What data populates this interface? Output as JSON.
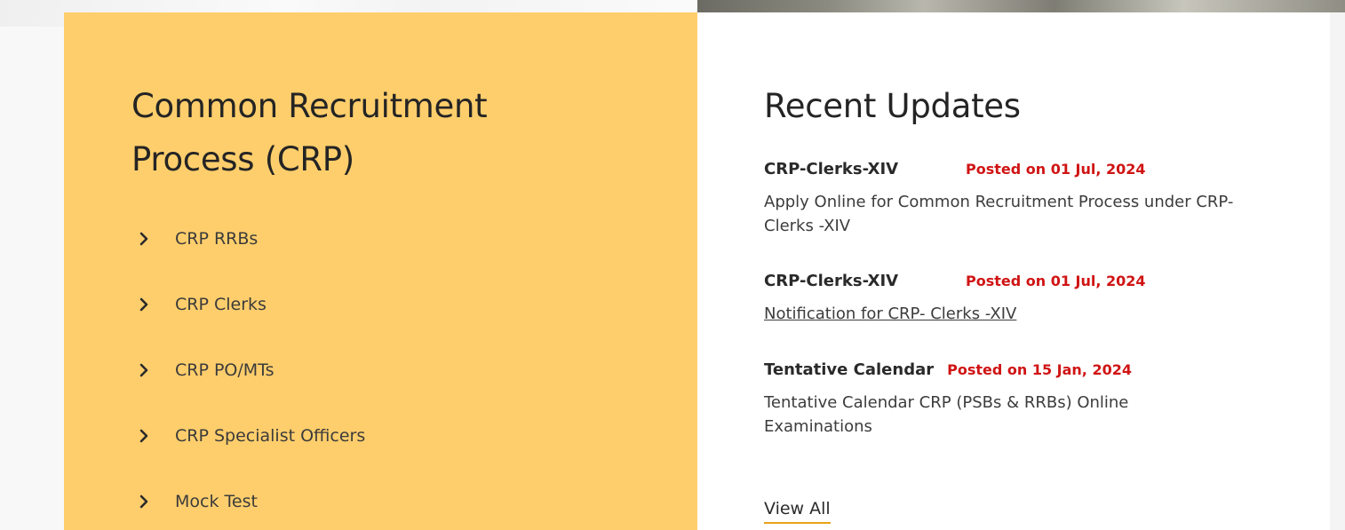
{
  "crp": {
    "title": "Common Recruitment Process (CRP)",
    "items": [
      {
        "label": "CRP RRBs",
        "icon": "chevron-right-icon"
      },
      {
        "label": "CRP Clerks",
        "icon": "chevron-right-icon"
      },
      {
        "label": "CRP PO/MTs",
        "icon": "chevron-right-icon"
      },
      {
        "label": "CRP Specialist Officers",
        "icon": "chevron-right-icon"
      },
      {
        "label": "Mock Test",
        "icon": "chevron-right-icon"
      }
    ]
  },
  "updates": {
    "title": "Recent Updates",
    "items": [
      {
        "name": "CRP-Clerks-XIV",
        "date": "Posted on 01 Jul, 2024",
        "description": "Apply Online for Common Recruitment Process under CRP- Clerks -XIV"
      },
      {
        "name": "CRP-Clerks-XIV",
        "date": "Posted on 01 Jul, 2024",
        "description": "Notification for CRP- Clerks -XIV"
      },
      {
        "name": "Tentative Calendar",
        "date": "Posted on 15 Jan, 2024",
        "description": "Tentative Calendar CRP (PSBs & RRBs) Online Examinations"
      }
    ],
    "view_all": "View All"
  },
  "colors": {
    "crp_panel": "#ffce6c",
    "date_red": "#d01414",
    "accent_underline": "#e8a317"
  }
}
